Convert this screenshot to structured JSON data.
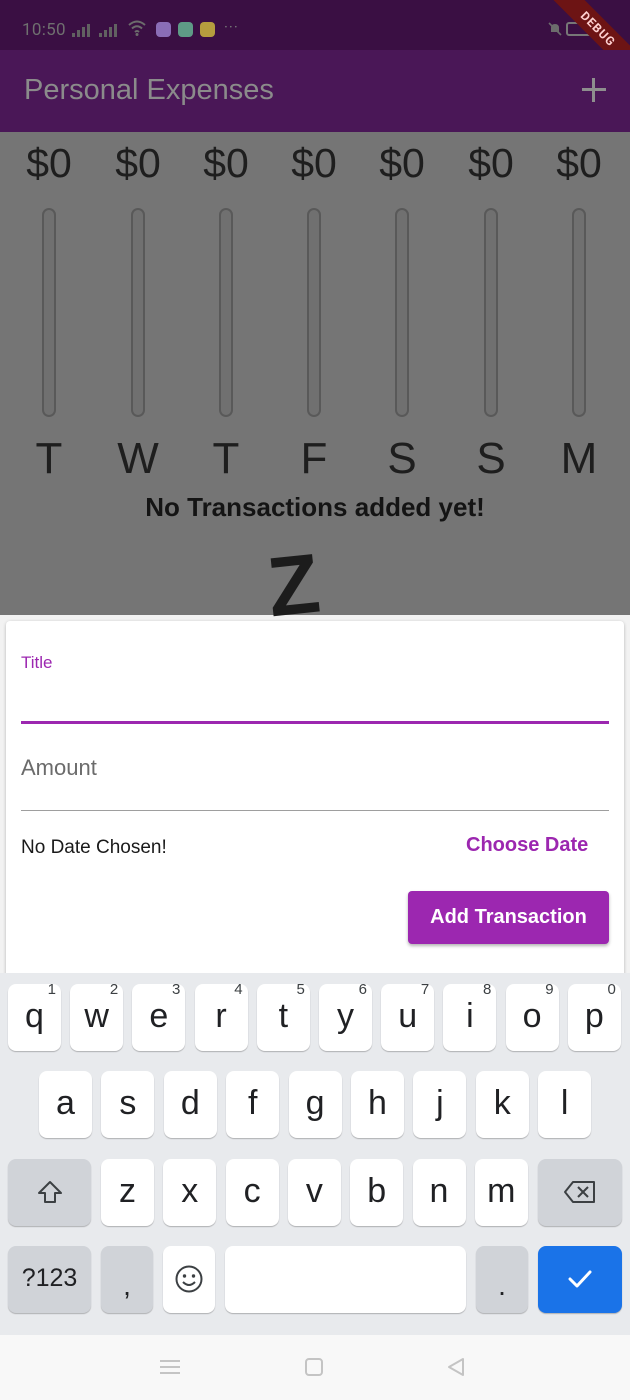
{
  "status_bar": {
    "time": "10:50",
    "debug_label": "DEBUG",
    "more": "···"
  },
  "app_bar": {
    "title": "Personal Expenses",
    "add_icon": "plus-icon"
  },
  "chart": {
    "bars": [
      {
        "amount": "$0",
        "day": "T",
        "fill": 0
      },
      {
        "amount": "$0",
        "day": "W",
        "fill": 0
      },
      {
        "amount": "$0",
        "day": "T",
        "fill": 0
      },
      {
        "amount": "$0",
        "day": "F",
        "fill": 0
      },
      {
        "amount": "$0",
        "day": "S",
        "fill": 0
      },
      {
        "amount": "$0",
        "day": "S",
        "fill": 0
      },
      {
        "amount": "$0",
        "day": "M",
        "fill": 0
      }
    ],
    "empty_message": "No Transactions added yet!",
    "empty_glyph": "Z"
  },
  "form": {
    "title_label": "Title",
    "title_value": "",
    "amount_label": "Amount",
    "amount_value": "",
    "date_text": "No Date Chosen!",
    "choose_date_label": "Choose Date",
    "submit_label": "Add Transaction"
  },
  "keyboard": {
    "row1": [
      {
        "label": "q",
        "hint": "1"
      },
      {
        "label": "w",
        "hint": "2"
      },
      {
        "label": "e",
        "hint": "3"
      },
      {
        "label": "r",
        "hint": "4"
      },
      {
        "label": "t",
        "hint": "5"
      },
      {
        "label": "y",
        "hint": "6"
      },
      {
        "label": "u",
        "hint": "7"
      },
      {
        "label": "i",
        "hint": "8"
      },
      {
        "label": "o",
        "hint": "9"
      },
      {
        "label": "p",
        "hint": "0"
      }
    ],
    "row2": [
      "a",
      "s",
      "d",
      "f",
      "g",
      "h",
      "j",
      "k",
      "l"
    ],
    "row3": [
      "z",
      "x",
      "c",
      "v",
      "b",
      "n",
      "m"
    ],
    "symbols_label": "?123",
    "comma_label": ",",
    "period_label": ".",
    "shift_icon": "shift-icon",
    "backspace_icon": "backspace-icon",
    "emoji_icon": "emoji-icon",
    "enter_icon": "checkmark-icon"
  },
  "colors": {
    "accent": "#9c27b0",
    "app_bar": "#4a1757",
    "enter_key": "#1a73e8"
  }
}
